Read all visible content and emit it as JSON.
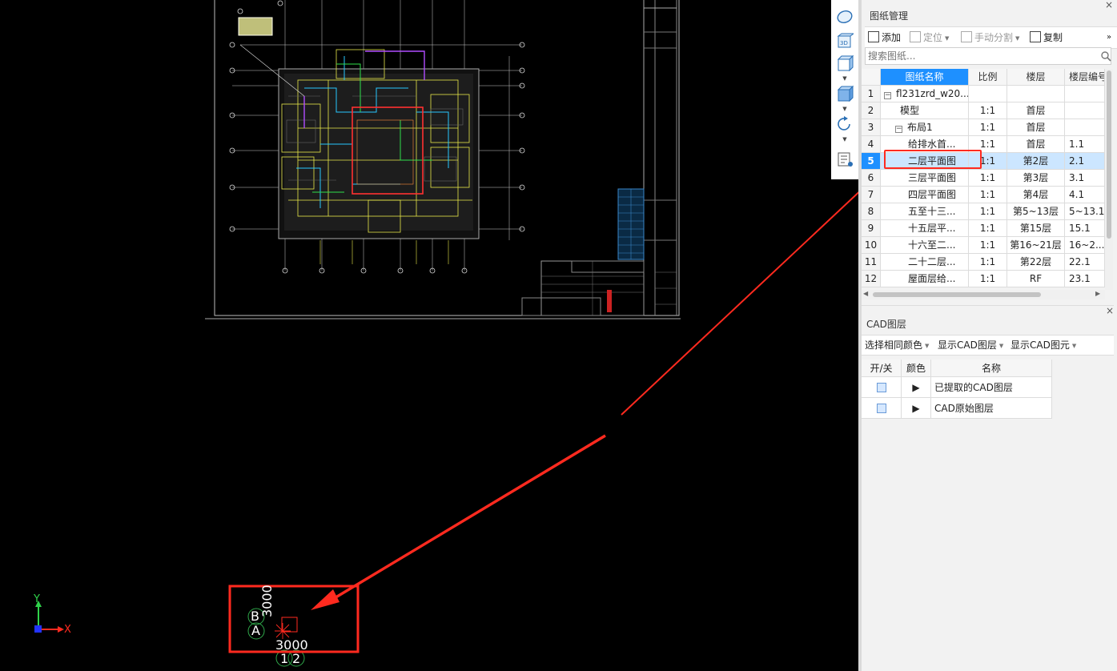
{
  "axis_indicator": {
    "y_label": "Y",
    "x_label": "X"
  },
  "grid_marker": {
    "row_labels": [
      "B",
      "A"
    ],
    "col_labels": [
      "1",
      "2"
    ],
    "vertical_dim": "3000",
    "horizontal_dim": "3000"
  },
  "drawing_panel": {
    "title": "图纸管理",
    "close_label": "×",
    "toolbar": {
      "add": "添加",
      "locate": "定位",
      "manual_split": "手动分割",
      "copy": "复制",
      "more": "»"
    },
    "search_placeholder": "搜索图纸...",
    "columns": [
      "图纸名称",
      "比例",
      "楼层",
      "楼层编号"
    ],
    "rows": [
      {
        "num": "1",
        "name": "fl231zrd_w20...",
        "scale": "",
        "floor": "",
        "code": "",
        "level": 0,
        "expander": "−"
      },
      {
        "num": "2",
        "name": "模型",
        "scale": "1:1",
        "floor": "首层",
        "code": "",
        "level": 1,
        "expander": ""
      },
      {
        "num": "3",
        "name": "布局1",
        "scale": "1:1",
        "floor": "首层",
        "code": "",
        "level": 1,
        "expander": "−"
      },
      {
        "num": "4",
        "name": "给排水首...",
        "scale": "1:1",
        "floor": "首层",
        "code": "1.1",
        "level": 2,
        "expander": ""
      },
      {
        "num": "5",
        "name": "二层平面图",
        "scale": "1:1",
        "floor": "第2层",
        "code": "2.1",
        "level": 2,
        "expander": "",
        "selected": true
      },
      {
        "num": "6",
        "name": "三层平面图",
        "scale": "1:1",
        "floor": "第3层",
        "code": "3.1",
        "level": 2,
        "expander": ""
      },
      {
        "num": "7",
        "name": "四层平面图",
        "scale": "1:1",
        "floor": "第4层",
        "code": "4.1",
        "level": 2,
        "expander": ""
      },
      {
        "num": "8",
        "name": "五至十三...",
        "scale": "1:1",
        "floor": "第5~13层",
        "code": "5~13.1",
        "level": 2,
        "expander": ""
      },
      {
        "num": "9",
        "name": "十五层平...",
        "scale": "1:1",
        "floor": "第15层",
        "code": "15.1",
        "level": 2,
        "expander": ""
      },
      {
        "num": "10",
        "name": "十六至二...",
        "scale": "1:1",
        "floor": "第16~21层",
        "code": "16~2...",
        "level": 2,
        "expander": ""
      },
      {
        "num": "11",
        "name": "二十二层...",
        "scale": "1:1",
        "floor": "第22层",
        "code": "22.1",
        "level": 2,
        "expander": ""
      },
      {
        "num": "12",
        "name": "屋面层给...",
        "scale": "1:1",
        "floor": "RF",
        "code": "23.1",
        "level": 2,
        "expander": ""
      }
    ]
  },
  "layer_panel": {
    "title": "CAD图层",
    "close_label": "×",
    "toolbar": {
      "select_same_color": "选择相同颜色",
      "show_cad_layer": "显示CAD图层",
      "show_cad_element": "显示CAD图元"
    },
    "columns": [
      "开/关",
      "颜色",
      "名称"
    ],
    "rows": [
      {
        "name": "已提取的CAD图层",
        "on": true
      },
      {
        "name": "CAD原始图层",
        "on": true
      }
    ]
  },
  "colors": {
    "annotation_red": "#ff2a1f",
    "selection_blue": "#1e90ff",
    "cad_yellow": "#e8e84a",
    "cad_cyan": "#27c7ff",
    "cad_magenta": "#b04cff",
    "grid_green": "#2fa84a"
  }
}
